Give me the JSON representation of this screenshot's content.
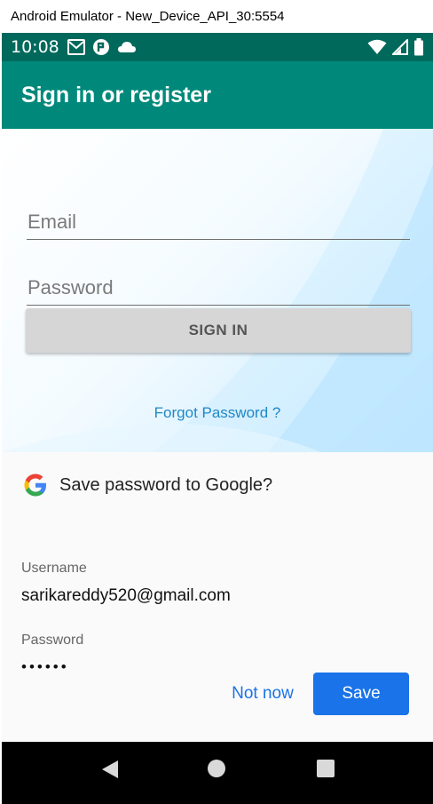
{
  "window": {
    "title": "Android Emulator - New_Device_API_30:5554"
  },
  "status_bar": {
    "time": "10:08",
    "icons_left": [
      "gmail-icon",
      "app-notification-icon",
      "cloud-icon"
    ],
    "icons_right": [
      "wifi-icon",
      "cell-signal-icon",
      "battery-icon"
    ]
  },
  "app_bar": {
    "title": "Sign in or register",
    "color": "#00897b",
    "status_color": "#00695c"
  },
  "login_form": {
    "email_placeholder": "Email",
    "password_placeholder": "Password",
    "signin_label": "SIGN IN",
    "forgot_label": "Forgot Password ?"
  },
  "save_password_sheet": {
    "title": "Save password to Google?",
    "username_label": "Username",
    "username_value": "sarikareddy520@gmail.com",
    "password_label": "Password",
    "password_value": "••••••",
    "not_now_label": "Not now",
    "save_label": "Save",
    "accent": "#1a73e8"
  },
  "nav_bar": {
    "buttons": [
      "back-icon",
      "home-icon",
      "recents-icon"
    ]
  }
}
